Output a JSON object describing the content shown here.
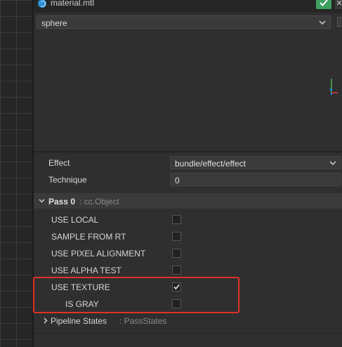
{
  "window": {
    "title": "material.mtl",
    "close_label": "✕"
  },
  "preview": {
    "mesh_select_value": "sphere"
  },
  "properties": {
    "effect_label": "Effect",
    "effect_value": "bundle/effect/effect",
    "technique_label": "Technique",
    "technique_value": "0"
  },
  "pass": {
    "name": "Pass 0",
    "type": ": cc.Object",
    "defines": [
      {
        "label": "USE LOCAL",
        "checked": false
      },
      {
        "label": "SAMPLE FROM RT",
        "checked": false
      },
      {
        "label": "USE PIXEL ALIGNMENT",
        "checked": false
      },
      {
        "label": "USE ALPHA TEST",
        "checked": false
      },
      {
        "label": "USE TEXTURE",
        "checked": true
      },
      {
        "label": "IS GRAY",
        "checked": false
      }
    ]
  },
  "pipeline": {
    "name": "Pipeline States",
    "type": ": PassStates"
  },
  "colors": {
    "accent_green": "#3ea05e",
    "highlight_red": "#e03326",
    "panel_bg": "#2f2f2f"
  },
  "icons": [
    "material-icon",
    "checkmark-icon",
    "close-icon",
    "chevron-down-icon",
    "axis-gizmo-icon",
    "chevron-right-icon"
  ]
}
